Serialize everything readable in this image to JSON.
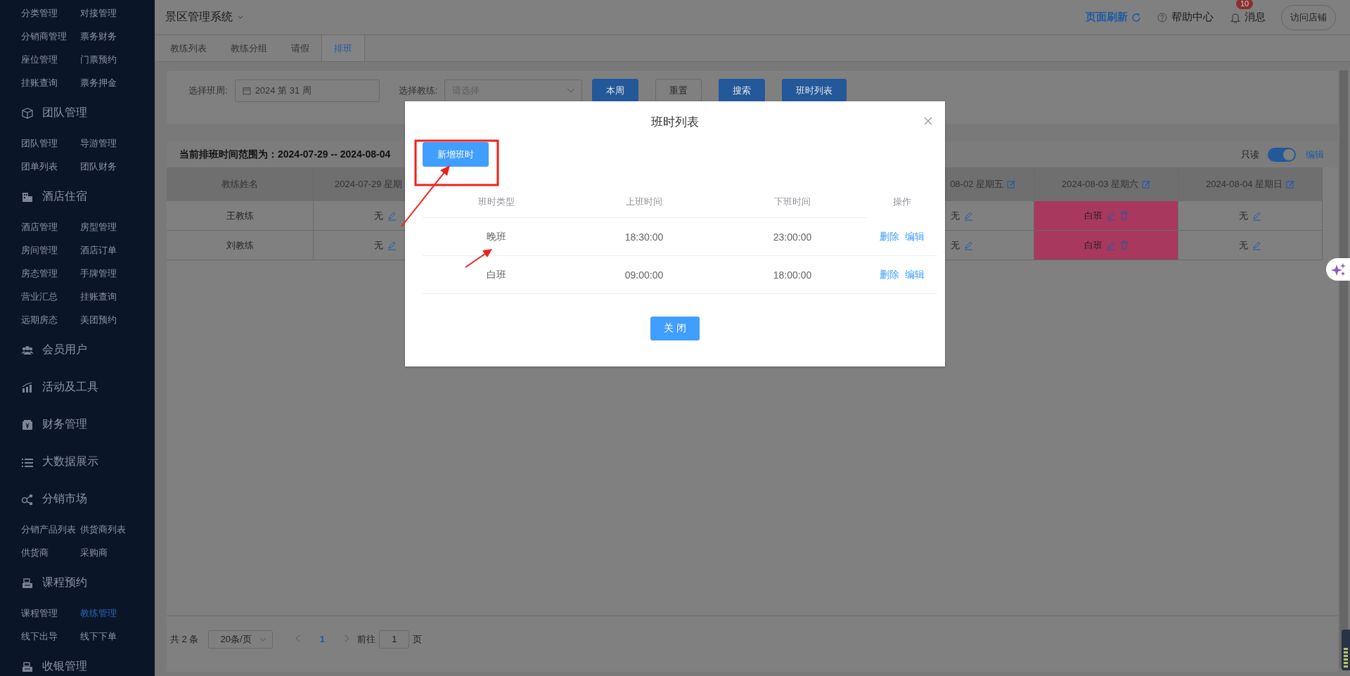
{
  "sidebar": {
    "sections": [
      {
        "items": [
          {
            "label": "分类管理",
            "selected": false
          },
          {
            "label": "对接管理",
            "selected": false
          },
          {
            "label": "分销商管理",
            "selected": false
          },
          {
            "label": "票务财务",
            "selected": false
          },
          {
            "label": "座位管理",
            "selected": false
          },
          {
            "label": "门票预约",
            "selected": false
          },
          {
            "label": "挂账查询",
            "selected": false
          },
          {
            "label": "票务押金",
            "selected": false
          }
        ]
      },
      {
        "title": "团队管理",
        "kind": "box",
        "items": [
          {
            "label": "团队管理",
            "selected": false
          },
          {
            "label": "导游管理",
            "selected": false
          },
          {
            "label": "团单列表",
            "selected": false
          },
          {
            "label": "团队财务",
            "selected": false
          }
        ]
      },
      {
        "title": "酒店住宿",
        "kind": "building",
        "items": [
          {
            "label": "酒店管理",
            "selected": false
          },
          {
            "label": "房型管理",
            "selected": false
          },
          {
            "label": "房间管理",
            "selected": false
          },
          {
            "label": "酒店订单",
            "selected": false
          },
          {
            "label": "房态管理",
            "selected": false
          },
          {
            "label": "手牌管理",
            "selected": false
          },
          {
            "label": "营业汇总",
            "selected": false
          },
          {
            "label": "挂账查询",
            "selected": false
          },
          {
            "label": "远期房态",
            "selected": false
          },
          {
            "label": "美团预约",
            "selected": false
          }
        ]
      },
      {
        "title": "会员用户",
        "kind": "people"
      },
      {
        "title": "活动及工具",
        "kind": "chart"
      },
      {
        "title": "财务管理",
        "kind": "wallet"
      },
      {
        "title": "大数据展示",
        "kind": "list"
      },
      {
        "title": "分销市场",
        "kind": "share",
        "items": [
          {
            "label": "分销产品列表",
            "selected": false
          },
          {
            "label": "供货商列表",
            "selected": false
          },
          {
            "label": "供货商",
            "selected": false
          },
          {
            "label": "采购商",
            "selected": false
          }
        ]
      },
      {
        "title": "课程预约",
        "kind": "register",
        "items": [
          {
            "label": "课程管理",
            "selected": false
          },
          {
            "label": "教练管理",
            "selected": true
          },
          {
            "label": "线下出导",
            "selected": false
          },
          {
            "label": "线下下单",
            "selected": false
          }
        ]
      },
      {
        "title": "收银管理",
        "kind": "register"
      }
    ]
  },
  "header": {
    "title": "景区管理系统",
    "refresh": "页面刷新",
    "help": "帮助中心",
    "messages": "消息",
    "message_badge": "10",
    "visit_shop": "访问店铺"
  },
  "tabs": [
    {
      "label": "教练列表",
      "selected": false
    },
    {
      "label": "教练分组",
      "selected": false
    },
    {
      "label": "请假",
      "selected": false
    },
    {
      "label": "排班",
      "selected": true
    }
  ],
  "filter": {
    "week_label": "选择班周:",
    "week_value": "2024 第 31 周",
    "coach_label": "选择教练:",
    "coach_placeholder": "请选择",
    "buttons": [
      {
        "label": "本周",
        "kind": "primary"
      },
      {
        "label": "重置",
        "kind": "plain"
      },
      {
        "label": "搜索",
        "kind": "primary"
      },
      {
        "label": "班时列表",
        "kind": "primary"
      }
    ]
  },
  "schedule": {
    "range": "当前排班时间范围为：2024-07-29 -- 2024-08-04",
    "readonly_label": "只读",
    "edit_mode": true,
    "edit_label": "编辑",
    "columns": [
      {
        "label": "教练姓名",
        "kind": "name"
      },
      {
        "label": "2024-07-29 星期",
        "kind": "date"
      },
      {
        "label": "08-02 星期五",
        "kind": "date"
      },
      {
        "label": "2024-08-03 星期六",
        "kind": "date"
      },
      {
        "label": "2024-08-04 星期日",
        "kind": "date"
      }
    ],
    "rows": [
      {
        "cells": [
          {
            "text": "王教练",
            "kind": "name"
          },
          {
            "text": "无",
            "kind": "rest"
          },
          {
            "text": "无",
            "kind": "rest"
          },
          {
            "text": "白班",
            "kind": "shift"
          },
          {
            "text": "无",
            "kind": "rest"
          }
        ]
      },
      {
        "cells": [
          {
            "text": "刘教练",
            "kind": "name"
          },
          {
            "text": "无",
            "kind": "rest"
          },
          {
            "text": "无",
            "kind": "rest"
          },
          {
            "text": "白班",
            "kind": "shift"
          },
          {
            "text": "无",
            "kind": "rest"
          }
        ]
      }
    ]
  },
  "pagination": {
    "total": "共 2 条",
    "page_size": "20条/页",
    "pages": [
      {
        "label": "1",
        "selected": true
      }
    ],
    "goto_label": "前往",
    "goto_value": "1",
    "page_suffix": "页"
  },
  "modal": {
    "title": "班时列表",
    "add_button": "新增班时",
    "columns": [
      "班时类型",
      "上班时间",
      "下班时间",
      "操作"
    ],
    "rows": [
      {
        "type": "晚班",
        "start": "18:30:00",
        "end": "23:00:00",
        "actions": [
          "删除",
          "编辑"
        ]
      },
      {
        "type": "白班",
        "start": "09:00:00",
        "end": "18:00:00",
        "actions": [
          "删除",
          "编辑"
        ]
      }
    ],
    "close_button": "关 闭"
  }
}
